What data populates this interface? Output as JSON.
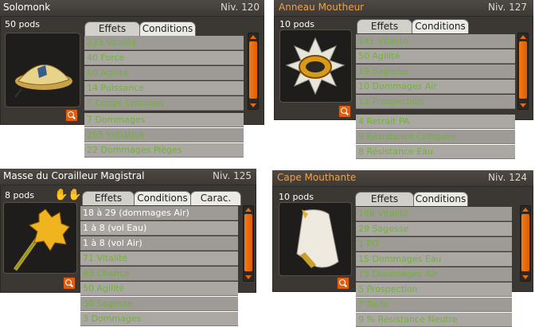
{
  "colors": {
    "title_white": "#ffffff",
    "title_orange": "#f0a24a",
    "effect_green": "#72b13a",
    "effect_white": "#ffffff",
    "accent_orange": "#e25d0e"
  },
  "items": [
    {
      "name": "Solomonk",
      "level": "Niv. 120",
      "pods": "50 pods",
      "tabs": [
        "Effets",
        "Conditions"
      ],
      "effects": [
        "223 Vitalité",
        "40 Force",
        "60 Agilité",
        "14 Puissance",
        "7 Coups Critiques",
        "7 Dommages",
        "265 Initiative",
        "22 Dommages Pièges"
      ]
    },
    {
      "name": "Anneau Moutheur",
      "level": "Niv. 127",
      "pods": "10 pods",
      "tabs": [
        "Effets",
        "Conditions"
      ],
      "effects": [
        "141 Vitalité",
        "50 Agilité",
        "19 Sagesse",
        "10 Dommages Air",
        "12 Prospection",
        "4 Retrait PA",
        "9 Résistance Critiques",
        "8 Résistance Eau"
      ]
    },
    {
      "name": "Masse du Corailleur Magistral",
      "level": "Niv. 125",
      "pods": "8 pods",
      "tabs": [
        "Effets",
        "Conditions",
        "Carac."
      ],
      "effects": [
        "18 à 29 (dommages Air)",
        "1 à 8 (vol Eau)",
        "1 à 8 (vol Air)",
        "71 Vitalité",
        "43 Chance",
        "50 Agilité",
        "30 Sagesse",
        "3 Dommages"
      ]
    },
    {
      "name": "Cape Mouthante",
      "level": "Niv. 124",
      "pods": "10 pods",
      "tabs": [
        "Effets",
        "Conditions"
      ],
      "effects": [
        "198 Vitalité",
        "29 Sagesse",
        "1 PO",
        "15 Dommages Eau",
        "15 Dommages Air",
        "5 Prospection",
        "7 Tacle",
        "9 % Résistance Neutre"
      ]
    }
  ]
}
